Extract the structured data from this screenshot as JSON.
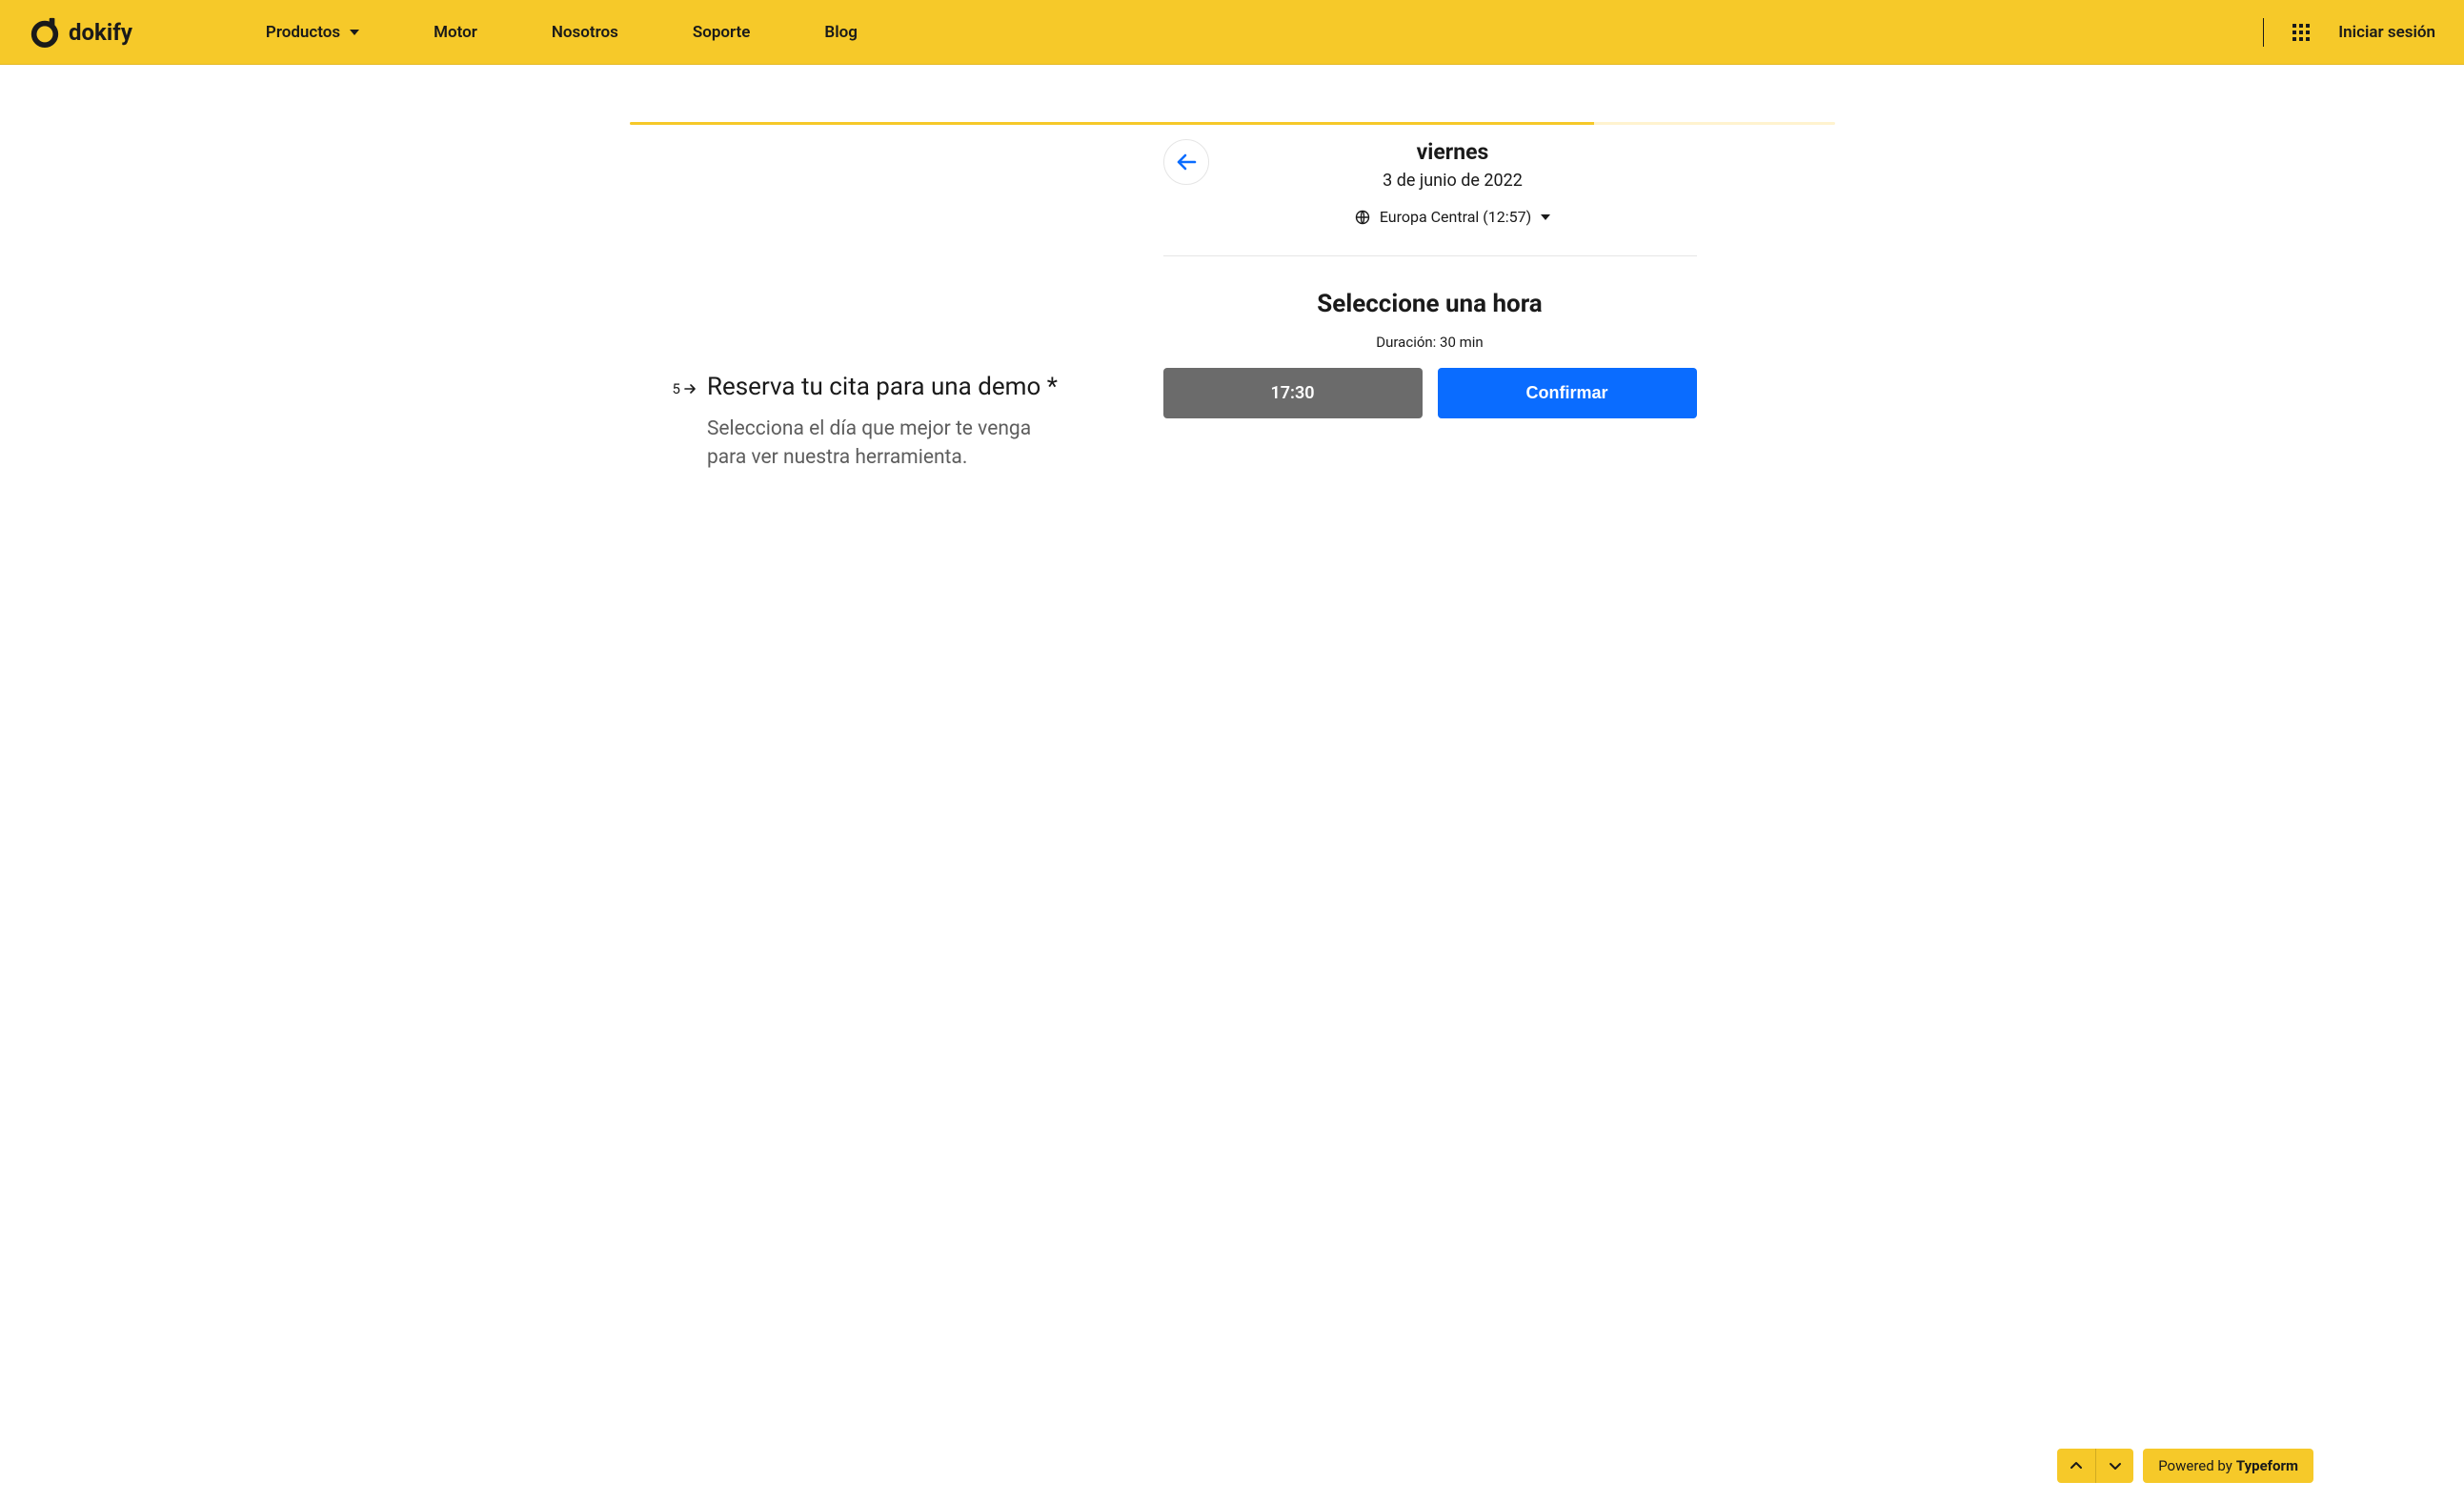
{
  "header": {
    "brand": "dokify",
    "nav": [
      {
        "label": "Productos",
        "has_dropdown": true
      },
      {
        "label": "Motor",
        "has_dropdown": false
      },
      {
        "label": "Nosotros",
        "has_dropdown": false
      },
      {
        "label": "Soporte",
        "has_dropdown": false
      },
      {
        "label": "Blog",
        "has_dropdown": false
      }
    ],
    "login": "Iniciar sesión"
  },
  "progress": {
    "percent": 80
  },
  "question": {
    "step_number": "5",
    "title": "Reserva tu cita para una demo *",
    "subtitle": "Selecciona el día que mejor te venga para ver nuestra herramienta."
  },
  "scheduler": {
    "day_name": "viernes",
    "full_date": "3 de junio de 2022",
    "timezone_label": "Europa Central (12:57)",
    "select_time_title": "Seleccione una hora",
    "duration_label": "Duración: 30 min",
    "selected_slot": "17:30",
    "confirm_label": "Confirmar"
  },
  "footer": {
    "powered_prefix": "Powered by ",
    "powered_brand": "Typeform"
  }
}
